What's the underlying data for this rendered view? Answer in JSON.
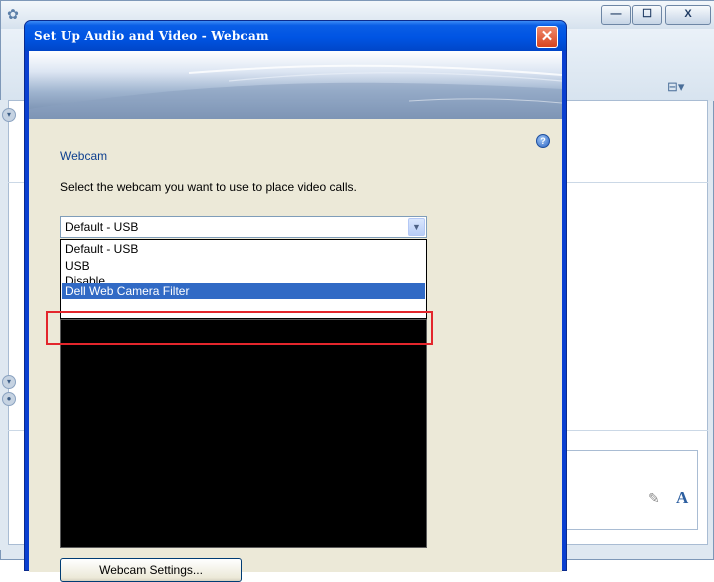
{
  "background_window": {
    "app_icon": "messenger-icon",
    "caption_buttons": {
      "minimize": "—",
      "maximize": "☐",
      "close": "X"
    },
    "toolbar_icon": "contacts-menu-icon",
    "font_icon_glyph": "A",
    "pen_icon_glyph": "✎"
  },
  "dialog": {
    "title": "Set Up Audio and Video - Webcam",
    "close_glyph": "✕",
    "help_glyph": "?",
    "heading": "Webcam",
    "instructions": "Select the webcam you want to use to place video calls.",
    "webcam_select": {
      "selected": "Default - USB",
      "arrow_glyph": "▼",
      "options": [
        "Default - USB",
        "USB",
        "Disable",
        "Dell Web Camera Filter"
      ],
      "highlighted_option": "Dell Web Camera Filter"
    },
    "settings_button": {
      "label": "Webcam Settings..."
    }
  },
  "colors": {
    "title_bar_blue": "#0054e3",
    "selection_blue": "#316ac5",
    "highlight_red": "#e3262c",
    "heading_blue": "#0e3f8f"
  }
}
